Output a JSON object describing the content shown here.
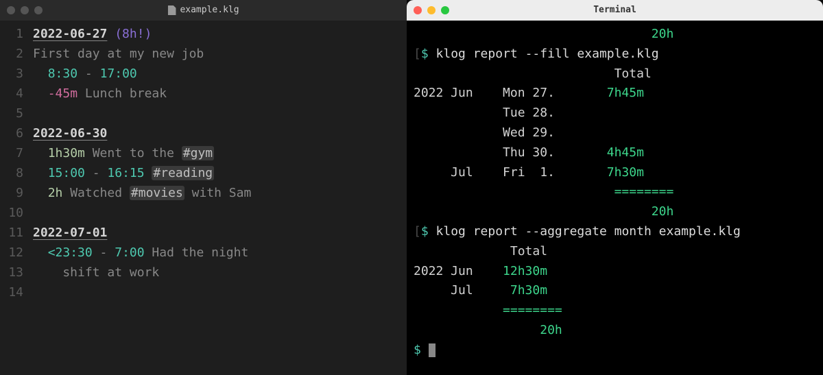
{
  "editor": {
    "filename": "example.klg",
    "lines": [
      {
        "num": "1",
        "seg": [
          {
            "t": "2022-06-27",
            "c": "date"
          },
          {
            "t": " ",
            "c": "plain"
          },
          {
            "t": "(8h!)",
            "c": "should"
          }
        ]
      },
      {
        "num": "2",
        "seg": [
          {
            "t": "First day at my new job",
            "c": "gray"
          }
        ]
      },
      {
        "num": "3",
        "seg": [
          {
            "t": "  ",
            "c": "plain"
          },
          {
            "t": "8:30",
            "c": "time"
          },
          {
            "t": " - ",
            "c": "op"
          },
          {
            "t": "17:00",
            "c": "time"
          }
        ]
      },
      {
        "num": "4",
        "seg": [
          {
            "t": "  ",
            "c": "plain"
          },
          {
            "t": "-45m",
            "c": "neg"
          },
          {
            "t": " Lunch break",
            "c": "gray"
          }
        ]
      },
      {
        "num": "5",
        "seg": []
      },
      {
        "num": "6",
        "seg": [
          {
            "t": "2022-06-30",
            "c": "date"
          }
        ]
      },
      {
        "num": "7",
        "seg": [
          {
            "t": "  ",
            "c": "plain"
          },
          {
            "t": "1h30m",
            "c": "dur"
          },
          {
            "t": " Went to the ",
            "c": "gray"
          },
          {
            "t": "#gym",
            "c": "tag"
          }
        ]
      },
      {
        "num": "8",
        "seg": [
          {
            "t": "  ",
            "c": "plain"
          },
          {
            "t": "15:00",
            "c": "time"
          },
          {
            "t": " - ",
            "c": "op"
          },
          {
            "t": "16:15",
            "c": "time"
          },
          {
            "t": " ",
            "c": "plain"
          },
          {
            "t": "#reading",
            "c": "tag"
          }
        ]
      },
      {
        "num": "9",
        "seg": [
          {
            "t": "  ",
            "c": "plain"
          },
          {
            "t": "2h",
            "c": "dur"
          },
          {
            "t": " Watched ",
            "c": "gray"
          },
          {
            "t": "#movies",
            "c": "tag"
          },
          {
            "t": " with Sam",
            "c": "gray"
          }
        ]
      },
      {
        "num": "10",
        "seg": []
      },
      {
        "num": "11",
        "seg": [
          {
            "t": "2022-07-01",
            "c": "date"
          }
        ]
      },
      {
        "num": "12",
        "seg": [
          {
            "t": "  ",
            "c": "plain"
          },
          {
            "t": "<23:30",
            "c": "time"
          },
          {
            "t": " - ",
            "c": "op"
          },
          {
            "t": "7:00",
            "c": "time"
          },
          {
            "t": " Had the night",
            "c": "gray"
          }
        ]
      },
      {
        "num": "13",
        "seg": [
          {
            "t": "    shift at work",
            "c": "gray"
          }
        ]
      },
      {
        "num": "14",
        "seg": []
      }
    ]
  },
  "terminal": {
    "title": "Terminal",
    "top_total": "20h",
    "cmd1": "klog report --fill example.klg",
    "cmd2": "klog report --aggregate month example.klg",
    "prompt": "$",
    "report1": {
      "header": "Total",
      "rows": [
        {
          "year": "2022",
          "month": "Jun",
          "dow": "Mon",
          "day": "27.",
          "val": "7h45m"
        },
        {
          "year": "",
          "month": "",
          "dow": "Tue",
          "day": "28.",
          "val": ""
        },
        {
          "year": "",
          "month": "",
          "dow": "Wed",
          "day": "29.",
          "val": ""
        },
        {
          "year": "",
          "month": "",
          "dow": "Thu",
          "day": "30.",
          "val": "4h45m"
        },
        {
          "year": "",
          "month": "Jul",
          "dow": "Fri",
          "day": " 1.",
          "val": "7h30m"
        }
      ],
      "sep": "========",
      "total": "20h"
    },
    "report2": {
      "header": "Total",
      "rows": [
        {
          "year": "2022",
          "month": "Jun",
          "val": "12h30m"
        },
        {
          "year": "",
          "month": "Jul",
          "val": "7h30m"
        }
      ],
      "sep": "========",
      "total": "20h"
    }
  }
}
